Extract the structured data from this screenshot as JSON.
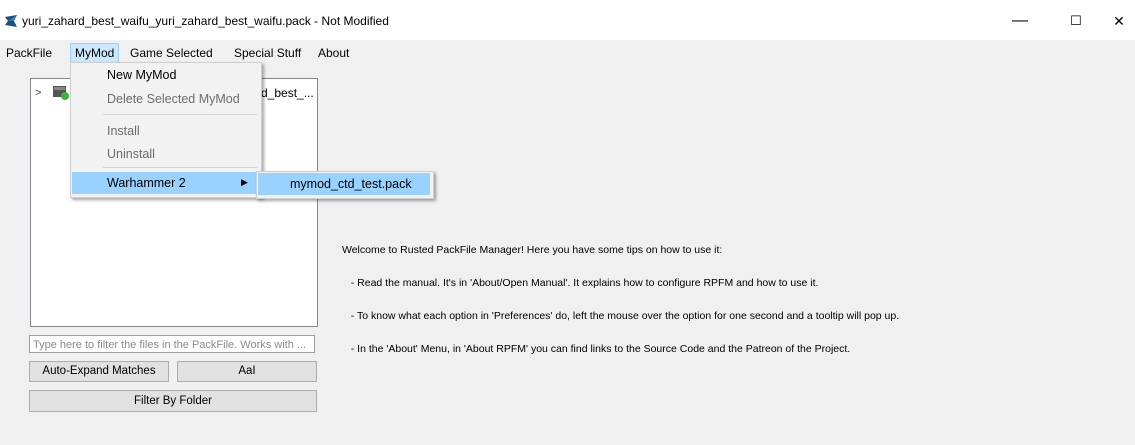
{
  "window": {
    "title": "yuri_zahard_best_waifu_yuri_zahard_best_waifu.pack - Not Modified",
    "app_icon": "rpfm-app-icon",
    "minimize_symbol": "—",
    "maximize_symbol": "☐",
    "close_symbol": "✕"
  },
  "menubar": {
    "items": [
      "PackFile",
      "MyMod",
      "Game Selected",
      "Special Stuff",
      "About"
    ],
    "active": "MyMod"
  },
  "mymod_menu": {
    "items": [
      {
        "label": "New MyMod",
        "enabled": true
      },
      {
        "label": "Delete Selected MyMod",
        "enabled": false
      },
      {
        "label": "Install",
        "enabled": false
      },
      {
        "label": "Uninstall",
        "enabled": false
      },
      {
        "label": "Warhammer 2",
        "enabled": true,
        "submenu": true
      }
    ],
    "submenu_arrow": "▶"
  },
  "warhammer2_submenu": {
    "items": [
      "mymod_ctd_test.pack"
    ]
  },
  "tree": {
    "expand_symbol": ">",
    "item_label": "d_best_..."
  },
  "filter": {
    "placeholder": "Type here to filter the files in the PackFile. Works with ..."
  },
  "buttons": {
    "auto_expand": "Auto-Expand Matches",
    "case_sensitive": "AaI",
    "filter_by_folder": "Filter By Folder"
  },
  "welcome": {
    "heading": "Welcome to Rusted PackFile Manager! Here you have some tips on how to use it:",
    "tips": [
      "   - Read the manual. It's in 'About/Open Manual'. It explains how to configure RPFM and how to use it.",
      "   - To know what each option in 'Preferences' do, left the mouse over the option for one second and a tooltip will pop up.",
      "   - In the 'About' Menu, in 'About RPFM' you can find links to the Source Code and the Patreon of the Project."
    ]
  }
}
